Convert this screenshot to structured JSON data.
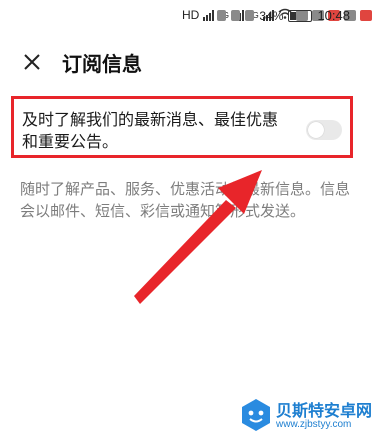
{
  "status_bar": {
    "net_labels": [
      "HD",
      "4G",
      "3G"
    ],
    "battery": "34%",
    "time": "10:48"
  },
  "header": {
    "title": "订阅信息",
    "close_icon": "close-icon"
  },
  "setting": {
    "label": "及时了解我们的最新消息、最佳优惠和重要公告。",
    "toggle_on": false
  },
  "description": "随时了解产品、服务、优惠活动的最新信息。信息会以邮件、短信、彩信或通知等形式发送。",
  "annotation": {
    "highlight_color": "#e8252a"
  },
  "watermark": {
    "text": "贝斯特安卓网",
    "url": "www.zjbstyy.com"
  }
}
